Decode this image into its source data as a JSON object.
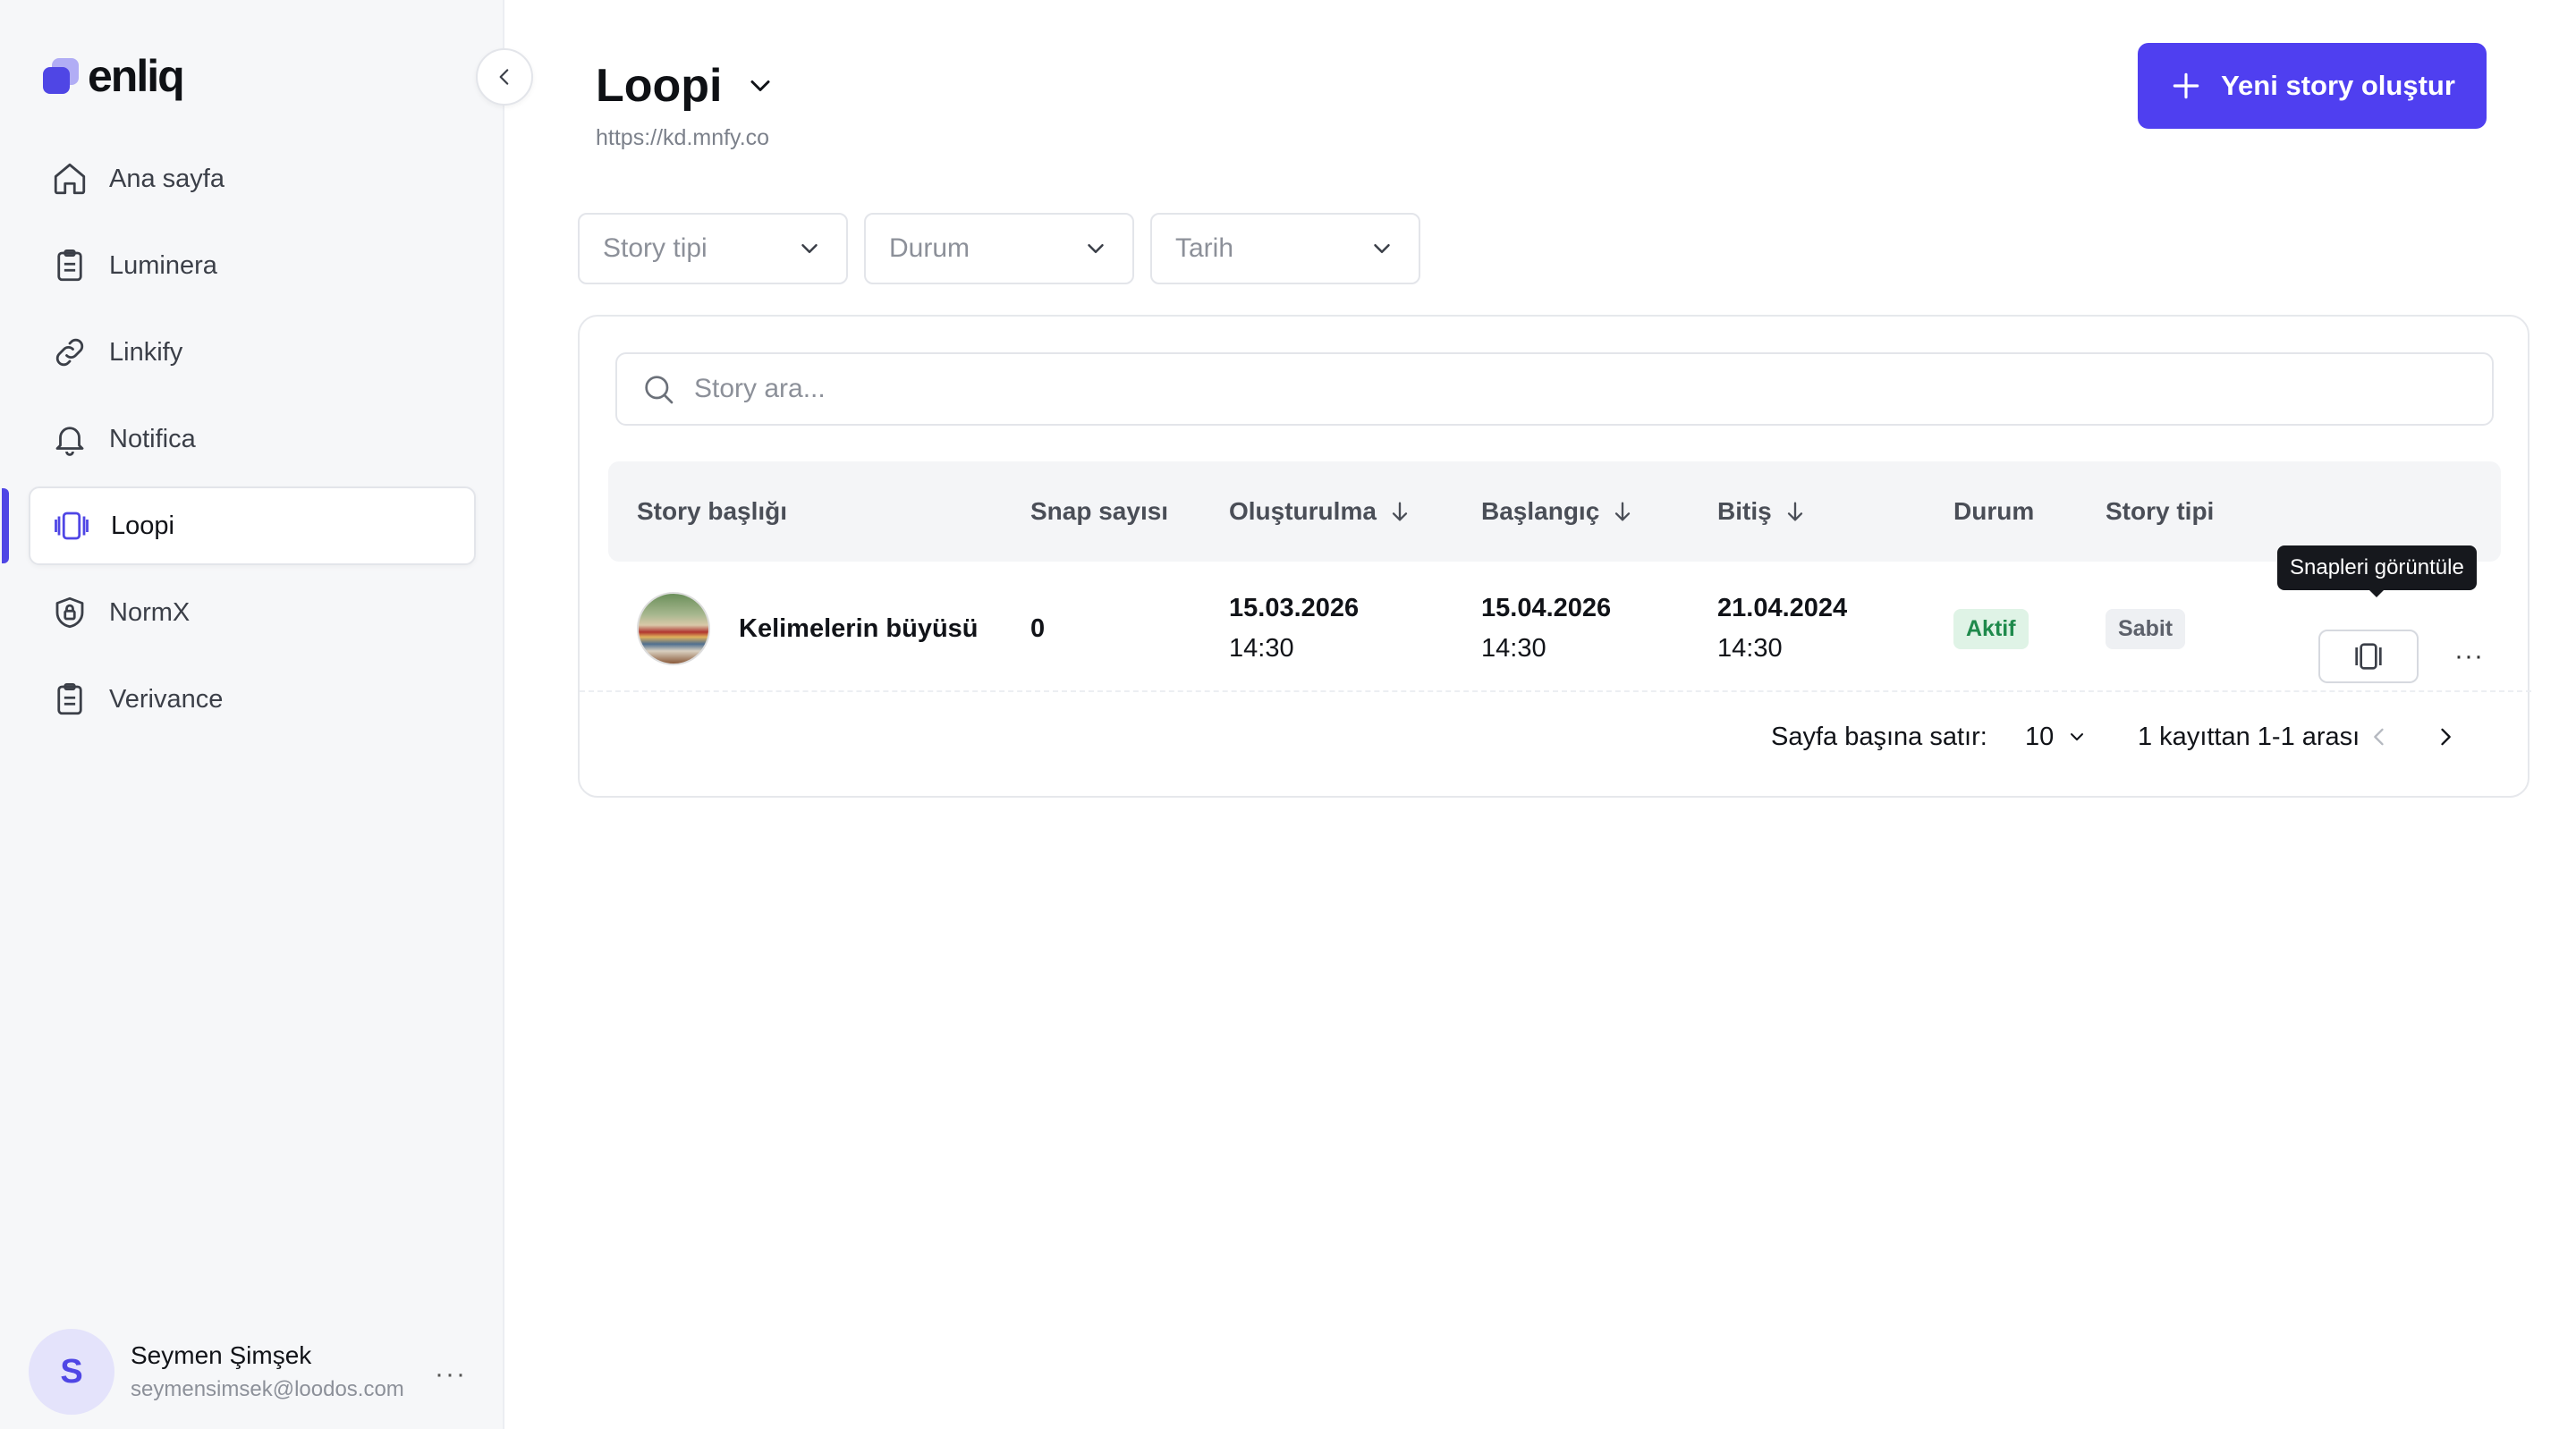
{
  "brand": {
    "name": "enliq",
    "accent": "#4f46e5"
  },
  "sidebar": {
    "items": [
      {
        "label": "Ana sayfa",
        "icon": "home-icon"
      },
      {
        "label": "Luminera",
        "icon": "clipboard-icon"
      },
      {
        "label": "Linkify",
        "icon": "link-icon"
      },
      {
        "label": "Notifica",
        "icon": "bell-icon"
      },
      {
        "label": "Loopi",
        "icon": "stories-icon",
        "active": true
      },
      {
        "label": "NormX",
        "icon": "shield-icon"
      },
      {
        "label": "Verivance",
        "icon": "clipboard-icon"
      }
    ],
    "user": {
      "initial": "S",
      "name": "Seymen Şimşek",
      "email": "seymensimsek@loodos.com",
      "more": "···"
    }
  },
  "header": {
    "title": "Loopi",
    "url": "https://kd.mnfy.co",
    "primary_button": "Yeni story oluştur"
  },
  "filters": {
    "story_type": "Story tipi",
    "status": "Durum",
    "date": "Tarih"
  },
  "search": {
    "placeholder": "Story ara..."
  },
  "table": {
    "columns": {
      "title": "Story başlığı",
      "snap_count": "Snap sayısı",
      "created": "Oluşturulma",
      "start": "Başlangıç",
      "end": "Bitiş",
      "status": "Durum",
      "type": "Story tipi"
    },
    "rows": [
      {
        "title": "Kelimelerin büyüsü",
        "snap_count": "0",
        "created_date": "15.03.2026",
        "created_time": "14:30",
        "start_date": "15.04.2026",
        "start_time": "14:30",
        "end_date": "21.04.2024",
        "end_time": "14:30",
        "status": "Aktif",
        "type": "Sabit",
        "more": "···"
      }
    ],
    "tooltip": "Snapleri görüntüle"
  },
  "pagination": {
    "rows_per_page_label": "Sayfa başına satır:",
    "rows_per_page": "10",
    "range": "1 kayıttan 1-1 arası"
  }
}
